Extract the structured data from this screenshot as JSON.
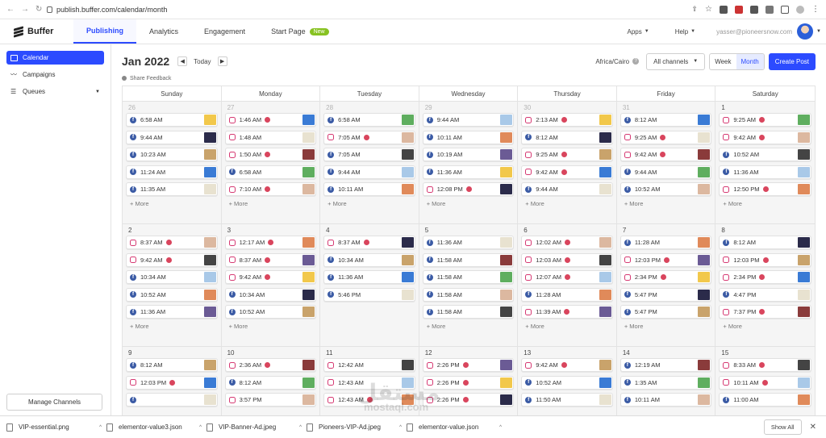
{
  "browser": {
    "url": "publish.buffer.com/calendar/month"
  },
  "app": {
    "logo": "Buffer"
  },
  "nav": {
    "tabs": [
      {
        "label": "Publishing",
        "active": true
      },
      {
        "label": "Analytics",
        "active": false
      },
      {
        "label": "Engagement",
        "active": false
      },
      {
        "label": "Start Page",
        "active": false,
        "badge": "New"
      }
    ],
    "apps": "Apps",
    "help": "Help",
    "email": "yasser@pioneersnow.com"
  },
  "sidebar": {
    "items": [
      {
        "label": "Calendar",
        "active": true
      },
      {
        "label": "Campaigns",
        "active": false
      },
      {
        "label": "Queues",
        "active": false
      }
    ],
    "manage": "Manage Channels"
  },
  "toolbar": {
    "month": "Jan 2022",
    "prev": "◀",
    "next": "▶",
    "today": "Today",
    "timezone": "Africa/Cairo",
    "channels": "All channels",
    "week": "Week",
    "monthBtn": "Month",
    "create": "Create Post",
    "feedback": "Share Feedback"
  },
  "calendar": {
    "days": [
      "Sunday",
      "Monday",
      "Tuesday",
      "Wednesday",
      "Thursday",
      "Friday",
      "Saturday"
    ],
    "more": "+ More",
    "weeks": [
      [
        {
          "num": "26",
          "past": true,
          "posts": [
            [
              "fb",
              "6:58 AM",
              0
            ],
            [
              "fb",
              "9:44 AM",
              0
            ],
            [
              "fb",
              "10:23 AM",
              0
            ],
            [
              "fb",
              "11:24 AM",
              0
            ],
            [
              "fb",
              "11:35 AM",
              0
            ]
          ]
        },
        {
          "num": "27",
          "past": true,
          "posts": [
            [
              "ig",
              "1:46 AM",
              1
            ],
            [
              "ig",
              "1:48 AM",
              0
            ],
            [
              "ig",
              "1:50 AM",
              1
            ],
            [
              "fb",
              "6:58 AM",
              0
            ],
            [
              "ig",
              "7:10 AM",
              1
            ]
          ]
        },
        {
          "num": "28",
          "past": true,
          "posts": [
            [
              "fb",
              "6:58 AM",
              0
            ],
            [
              "ig",
              "7:05 AM",
              1
            ],
            [
              "fb",
              "7:05 AM",
              0
            ],
            [
              "fb",
              "9:44 AM",
              0
            ],
            [
              "fb",
              "10:11 AM",
              0
            ]
          ]
        },
        {
          "num": "29",
          "past": true,
          "posts": [
            [
              "fb",
              "9:44 AM",
              0
            ],
            [
              "fb",
              "10:11 AM",
              0
            ],
            [
              "fb",
              "10:19 AM",
              0
            ],
            [
              "fb",
              "11:36 AM",
              0
            ],
            [
              "ig",
              "12:08 PM",
              1
            ]
          ]
        },
        {
          "num": "30",
          "past": true,
          "posts": [
            [
              "ig",
              "2:13 AM",
              1
            ],
            [
              "fb",
              "8:12 AM",
              0
            ],
            [
              "ig",
              "9:25 AM",
              1
            ],
            [
              "ig",
              "9:42 AM",
              1
            ],
            [
              "fb",
              "9:44 AM",
              0
            ]
          ]
        },
        {
          "num": "31",
          "past": true,
          "posts": [
            [
              "fb",
              "8:12 AM",
              0
            ],
            [
              "ig",
              "9:25 AM",
              1
            ],
            [
              "ig",
              "9:42 AM",
              1
            ],
            [
              "fb",
              "9:44 AM",
              0
            ],
            [
              "fb",
              "10:52 AM",
              0
            ]
          ]
        },
        {
          "num": "1",
          "past": false,
          "posts": [
            [
              "ig",
              "9:25 AM",
              1
            ],
            [
              "ig",
              "9:42 AM",
              1
            ],
            [
              "fb",
              "10:52 AM",
              0
            ],
            [
              "fb",
              "11:36 AM",
              0
            ],
            [
              "ig",
              "12:50 PM",
              1
            ]
          ]
        }
      ],
      [
        {
          "num": "2",
          "past": false,
          "posts": [
            [
              "ig",
              "8:37 AM",
              1
            ],
            [
              "ig",
              "9:42 AM",
              1
            ],
            [
              "fb",
              "10:34 AM",
              0
            ],
            [
              "fb",
              "10:52 AM",
              0
            ],
            [
              "fb",
              "11:36 AM",
              0
            ]
          ]
        },
        {
          "num": "3",
          "past": false,
          "posts": [
            [
              "ig",
              "12:17 AM",
              1
            ],
            [
              "ig",
              "8:37 AM",
              1
            ],
            [
              "ig",
              "9:42 AM",
              1
            ],
            [
              "fb",
              "10:34 AM",
              0
            ],
            [
              "fb",
              "10:52 AM",
              0
            ]
          ]
        },
        {
          "num": "4",
          "past": false,
          "more": false,
          "posts": [
            [
              "ig",
              "8:37 AM",
              1
            ],
            [
              "fb",
              "10:34 AM",
              0
            ],
            [
              "fb",
              "11:36 AM",
              0
            ],
            [
              "fb",
              "5:46 PM",
              0
            ]
          ]
        },
        {
          "num": "5",
          "past": false,
          "posts": [
            [
              "fb",
              "11:36 AM",
              0
            ],
            [
              "fb",
              "11:58 AM",
              0
            ],
            [
              "fb",
              "11:58 AM",
              0
            ],
            [
              "fb",
              "11:58 AM",
              0
            ],
            [
              "fb",
              "11:58 AM",
              0
            ]
          ]
        },
        {
          "num": "6",
          "past": false,
          "posts": [
            [
              "ig",
              "12:02 AM",
              1
            ],
            [
              "ig",
              "12:03 AM",
              1
            ],
            [
              "ig",
              "12:07 AM",
              1
            ],
            [
              "fb",
              "11:28 AM",
              0
            ],
            [
              "ig",
              "11:39 AM",
              1
            ]
          ]
        },
        {
          "num": "7",
          "past": false,
          "posts": [
            [
              "fb",
              "11:28 AM",
              0
            ],
            [
              "ig",
              "12:03 PM",
              1
            ],
            [
              "ig",
              "2:34 PM",
              1
            ],
            [
              "fb",
              "5:47 PM",
              0
            ],
            [
              "fb",
              "5:47 PM",
              0
            ]
          ]
        },
        {
          "num": "8",
          "past": false,
          "posts": [
            [
              "fb",
              "8:12 AM",
              0
            ],
            [
              "ig",
              "12:03 PM",
              1
            ],
            [
              "ig",
              "2:34 PM",
              1
            ],
            [
              "fb",
              "4:47 PM",
              0
            ],
            [
              "ig",
              "7:37 PM",
              1
            ]
          ]
        }
      ],
      [
        {
          "num": "9",
          "past": false,
          "more": false,
          "posts": [
            [
              "fb",
              "8:12 AM",
              0
            ],
            [
              "ig",
              "12:03 PM",
              1
            ],
            [
              "fb",
              "",
              0
            ]
          ]
        },
        {
          "num": "10",
          "past": false,
          "more": false,
          "posts": [
            [
              "ig",
              "2:36 AM",
              1
            ],
            [
              "fb",
              "8:12 AM",
              0
            ],
            [
              "ig",
              "3:57 PM",
              0
            ]
          ]
        },
        {
          "num": "11",
          "past": false,
          "more": false,
          "posts": [
            [
              "ig",
              "12:42 AM",
              0
            ],
            [
              "ig",
              "12:43 AM",
              0
            ],
            [
              "ig",
              "12:43 AM",
              1
            ]
          ]
        },
        {
          "num": "12",
          "past": false,
          "more": false,
          "posts": [
            [
              "ig",
              "2:26 PM",
              1
            ],
            [
              "ig",
              "2:26 PM",
              1
            ],
            [
              "ig",
              "2:26 PM",
              1
            ]
          ]
        },
        {
          "num": "13",
          "past": false,
          "more": false,
          "posts": [
            [
              "ig",
              "9:42 AM",
              1
            ],
            [
              "fb",
              "10:52 AM",
              0
            ],
            [
              "fb",
              "11:50 AM",
              0
            ]
          ]
        },
        {
          "num": "14",
          "past": false,
          "more": false,
          "posts": [
            [
              "fb",
              "12:19 AM",
              0
            ],
            [
              "fb",
              "1:35 AM",
              0
            ],
            [
              "fb",
              "10:11 AM",
              0
            ]
          ]
        },
        {
          "num": "15",
          "past": false,
          "more": false,
          "posts": [
            [
              "ig",
              "8:33 AM",
              1
            ],
            [
              "ig",
              "10:11 AM",
              1
            ],
            [
              "fb",
              "11:00 AM",
              0
            ]
          ]
        }
      ]
    ]
  },
  "downloads": {
    "files": [
      "VIP-essential.png",
      "elementor-value3.json",
      "VIP-Banner-Ad.jpeg",
      "Pioneers-VIP-Ad.jpeg",
      "elementor-value.json"
    ],
    "showAll": "Show All"
  },
  "colors": {
    "accent": "#2c4bff",
    "facebook": "#3b5ba5",
    "instagram": "#d63a73",
    "warning": "#d9455d"
  }
}
